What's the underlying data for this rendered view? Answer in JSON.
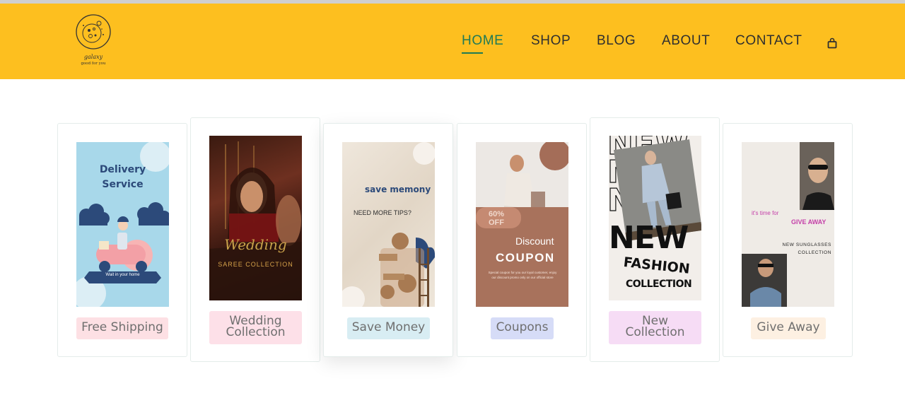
{
  "brand": {
    "name": "galaxy",
    "tagline": "good for you"
  },
  "nav": {
    "items": [
      {
        "label": "HOME",
        "active": true
      },
      {
        "label": "SHOP",
        "active": false
      },
      {
        "label": "BLOG",
        "active": false
      },
      {
        "label": "ABOUT",
        "active": false
      },
      {
        "label": "CONTACT",
        "active": false
      }
    ],
    "cart_icon": "shopping-bag-icon"
  },
  "colors": {
    "header": "#fdbf1f",
    "active": "#1f7a55",
    "text": "#2f2f2f"
  },
  "cards": [
    {
      "label": "Free Shipping",
      "label_bg": "#fde0e4",
      "poster": {
        "title_line1": "Delivery",
        "title_line2": "Service",
        "ribbon": "Wait in your home"
      }
    },
    {
      "label_line1": "Wedding",
      "label_line2": "Collection",
      "label_bg": "#fde0e8",
      "poster": {
        "script": "Wedding",
        "subtitle": "SAREE COLLECTION"
      }
    },
    {
      "label": "Save Money",
      "label_bg": "#d8edf3",
      "poster": {
        "title": "save memony",
        "subtitle": "NEED MORE TIPS?"
      }
    },
    {
      "label": "Coupons",
      "label_bg": "#d6dcf7",
      "poster": {
        "badge_pct": "60%",
        "badge_off": "OFF",
        "discount": "Discount",
        "coupon": "COUPON",
        "fine1": "Special coupon for you our loyal customer, enjoy",
        "fine2": "our discount promo only on our official store"
      }
    },
    {
      "label_line1": "New",
      "label_line2": "Collection",
      "label_bg": "#f6dcf5",
      "poster": {
        "big": "NEW",
        "line1": "FASHION",
        "line2": "COLLECTION"
      }
    },
    {
      "label": "Give Away",
      "label_bg": "#fdf0e2",
      "poster": {
        "intro": "it's time for",
        "title": "GIVE AWAY",
        "sub1": "NEW SUNGLASSES",
        "sub2": "COLLECTION"
      }
    }
  ]
}
